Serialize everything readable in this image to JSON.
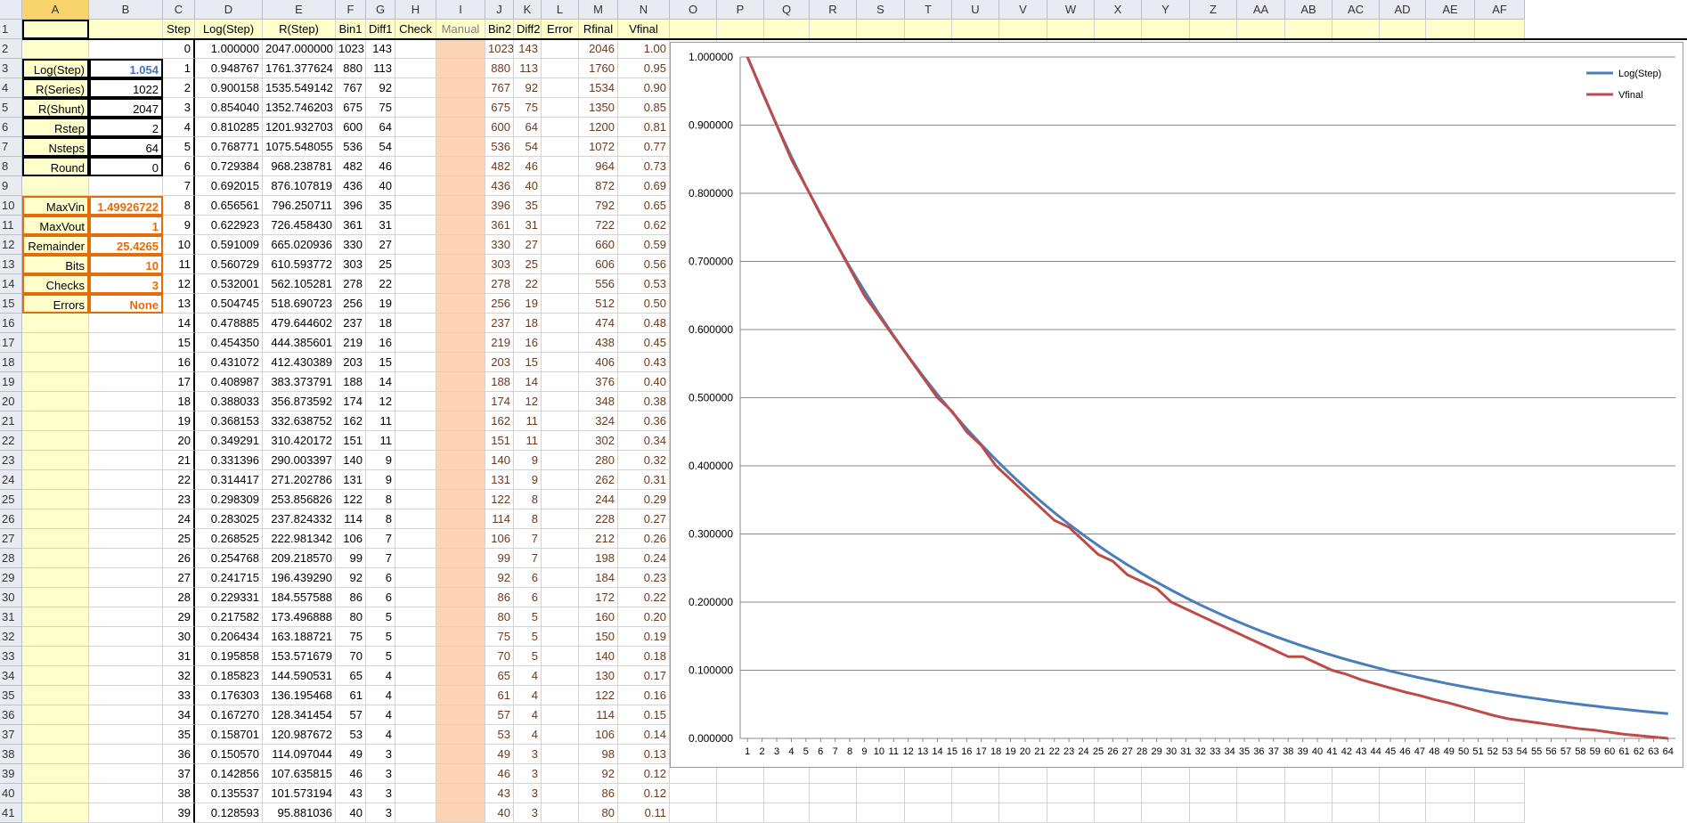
{
  "col_headers": [
    "A",
    "B",
    "C",
    "D",
    "E",
    "F",
    "G",
    "H",
    "I",
    "J",
    "K",
    "L",
    "M",
    "N",
    "O",
    "P",
    "Q",
    "R",
    "S",
    "T",
    "U",
    "V",
    "W",
    "X",
    "Y",
    "Z",
    "AA",
    "AB",
    "AC",
    "AD",
    "AE",
    "AF"
  ],
  "row1_headers": [
    "",
    "",
    "Step",
    "Log(Step)",
    "R(Step)",
    "Bin1",
    "Diff1",
    "Check",
    "Manual",
    "Bin2",
    "Diff2",
    "Error",
    "Rfinal",
    "Vfinal"
  ],
  "params_blue": [
    {
      "label": "Log(Step)",
      "value": "1.054"
    },
    {
      "label": "R(Series)",
      "value": "1022"
    },
    {
      "label": "R(Shunt)",
      "value": "2047"
    },
    {
      "label": "Rstep",
      "value": "2"
    },
    {
      "label": "Nsteps",
      "value": "64"
    },
    {
      "label": "Round",
      "value": "0"
    }
  ],
  "params_orange": [
    {
      "label": "MaxVin",
      "value": "1.49926722"
    },
    {
      "label": "MaxVout",
      "value": "1"
    },
    {
      "label": "Remainder",
      "value": "25.4265"
    },
    {
      "label": "Bits",
      "value": "10"
    },
    {
      "label": "Checks",
      "value": "3"
    },
    {
      "label": "Errors",
      "value": "None"
    }
  ],
  "rows": [
    [
      "0",
      "1.000000",
      "2047.000000",
      "1023",
      "143",
      "1023",
      "143",
      "2046",
      "1.00"
    ],
    [
      "1",
      "0.948767",
      "1761.377624",
      "880",
      "113",
      "880",
      "113",
      "1760",
      "0.95"
    ],
    [
      "2",
      "0.900158",
      "1535.549142",
      "767",
      "92",
      "767",
      "92",
      "1534",
      "0.90"
    ],
    [
      "3",
      "0.854040",
      "1352.746203",
      "675",
      "75",
      "675",
      "75",
      "1350",
      "0.85"
    ],
    [
      "4",
      "0.810285",
      "1201.932703",
      "600",
      "64",
      "600",
      "64",
      "1200",
      "0.81"
    ],
    [
      "5",
      "0.768771",
      "1075.548055",
      "536",
      "54",
      "536",
      "54",
      "1072",
      "0.77"
    ],
    [
      "6",
      "0.729384",
      "968.238781",
      "482",
      "46",
      "482",
      "46",
      "964",
      "0.73"
    ],
    [
      "7",
      "0.692015",
      "876.107819",
      "436",
      "40",
      "436",
      "40",
      "872",
      "0.69"
    ],
    [
      "8",
      "0.656561",
      "796.250711",
      "396",
      "35",
      "396",
      "35",
      "792",
      "0.65"
    ],
    [
      "9",
      "0.622923",
      "726.458430",
      "361",
      "31",
      "361",
      "31",
      "722",
      "0.62"
    ],
    [
      "10",
      "0.591009",
      "665.020936",
      "330",
      "27",
      "330",
      "27",
      "660",
      "0.59"
    ],
    [
      "11",
      "0.560729",
      "610.593772",
      "303",
      "25",
      "303",
      "25",
      "606",
      "0.56"
    ],
    [
      "12",
      "0.532001",
      "562.105281",
      "278",
      "22",
      "278",
      "22",
      "556",
      "0.53"
    ],
    [
      "13",
      "0.504745",
      "518.690723",
      "256",
      "19",
      "256",
      "19",
      "512",
      "0.50"
    ],
    [
      "14",
      "0.478885",
      "479.644602",
      "237",
      "18",
      "237",
      "18",
      "474",
      "0.48"
    ],
    [
      "15",
      "0.454350",
      "444.385601",
      "219",
      "16",
      "219",
      "16",
      "438",
      "0.45"
    ],
    [
      "16",
      "0.431072",
      "412.430389",
      "203",
      "15",
      "203",
      "15",
      "406",
      "0.43"
    ],
    [
      "17",
      "0.408987",
      "383.373791",
      "188",
      "14",
      "188",
      "14",
      "376",
      "0.40"
    ],
    [
      "18",
      "0.388033",
      "356.873592",
      "174",
      "12",
      "174",
      "12",
      "348",
      "0.38"
    ],
    [
      "19",
      "0.368153",
      "332.638752",
      "162",
      "11",
      "162",
      "11",
      "324",
      "0.36"
    ],
    [
      "20",
      "0.349291",
      "310.420172",
      "151",
      "11",
      "151",
      "11",
      "302",
      "0.34"
    ],
    [
      "21",
      "0.331396",
      "290.003397",
      "140",
      "9",
      "140",
      "9",
      "280",
      "0.32"
    ],
    [
      "22",
      "0.314417",
      "271.202786",
      "131",
      "9",
      "131",
      "9",
      "262",
      "0.31"
    ],
    [
      "23",
      "0.298309",
      "253.856826",
      "122",
      "8",
      "122",
      "8",
      "244",
      "0.29"
    ],
    [
      "24",
      "0.283025",
      "237.824332",
      "114",
      "8",
      "114",
      "8",
      "228",
      "0.27"
    ],
    [
      "25",
      "0.268525",
      "222.981342",
      "106",
      "7",
      "106",
      "7",
      "212",
      "0.26"
    ],
    [
      "26",
      "0.254768",
      "209.218570",
      "99",
      "7",
      "99",
      "7",
      "198",
      "0.24"
    ],
    [
      "27",
      "0.241715",
      "196.439290",
      "92",
      "6",
      "92",
      "6",
      "184",
      "0.23"
    ],
    [
      "28",
      "0.229331",
      "184.557588",
      "86",
      "6",
      "86",
      "6",
      "172",
      "0.22"
    ],
    [
      "29",
      "0.217582",
      "173.496888",
      "80",
      "5",
      "80",
      "5",
      "160",
      "0.20"
    ],
    [
      "30",
      "0.206434",
      "163.188721",
      "75",
      "5",
      "75",
      "5",
      "150",
      "0.19"
    ],
    [
      "31",
      "0.195858",
      "153.571679",
      "70",
      "5",
      "70",
      "5",
      "140",
      "0.18"
    ],
    [
      "32",
      "0.185823",
      "144.590531",
      "65",
      "4",
      "65",
      "4",
      "130",
      "0.17"
    ],
    [
      "33",
      "0.176303",
      "136.195468",
      "61",
      "4",
      "61",
      "4",
      "122",
      "0.16"
    ],
    [
      "34",
      "0.167270",
      "128.341454",
      "57",
      "4",
      "57",
      "4",
      "114",
      "0.15"
    ],
    [
      "35",
      "0.158701",
      "120.987672",
      "53",
      "4",
      "53",
      "4",
      "106",
      "0.14"
    ],
    [
      "36",
      "0.150570",
      "114.097044",
      "49",
      "3",
      "49",
      "3",
      "98",
      "0.13"
    ],
    [
      "37",
      "0.142856",
      "107.635815",
      "46",
      "3",
      "46",
      "3",
      "92",
      "0.12"
    ],
    [
      "38",
      "0.135537",
      "101.573194",
      "43",
      "3",
      "43",
      "3",
      "86",
      "0.12"
    ],
    [
      "39",
      "0.128593",
      "95.881036",
      "40",
      "3",
      "40",
      "3",
      "80",
      "0.11"
    ]
  ],
  "chart_data": {
    "type": "line",
    "title": "",
    "xlabel": "",
    "ylabel": "",
    "legend_position": "top-right",
    "grid": true,
    "x": [
      1,
      2,
      3,
      4,
      5,
      6,
      7,
      8,
      9,
      10,
      11,
      12,
      13,
      14,
      15,
      16,
      17,
      18,
      19,
      20,
      21,
      22,
      23,
      24,
      25,
      26,
      27,
      28,
      29,
      30,
      31,
      32,
      33,
      34,
      35,
      36,
      37,
      38,
      39,
      40,
      41,
      42,
      43,
      44,
      45,
      46,
      47,
      48,
      49,
      50,
      51,
      52,
      53,
      54,
      55,
      56,
      57,
      58,
      59,
      60,
      61,
      62,
      63,
      64
    ],
    "ylim": [
      0,
      1
    ],
    "yticks": [
      "0.000000",
      "0.100000",
      "0.200000",
      "0.300000",
      "0.400000",
      "0.500000",
      "0.600000",
      "0.700000",
      "0.800000",
      "0.900000",
      "1.000000"
    ],
    "series": [
      {
        "name": "Log(Step)",
        "color": "#4a7ebb",
        "values": [
          1.0,
          0.948767,
          0.900158,
          0.85404,
          0.810285,
          0.768771,
          0.729384,
          0.692015,
          0.656561,
          0.622923,
          0.591009,
          0.560729,
          0.532001,
          0.504745,
          0.478885,
          0.45435,
          0.431072,
          0.408987,
          0.388033,
          0.368153,
          0.349291,
          0.331396,
          0.314417,
          0.298309,
          0.283025,
          0.268525,
          0.254768,
          0.241715,
          0.229331,
          0.217582,
          0.206434,
          0.195858,
          0.185823,
          0.176303,
          0.16727,
          0.158701,
          0.15057,
          0.142856,
          0.135537,
          0.128593,
          0.122,
          0.1157,
          0.1098,
          0.1042,
          0.0988,
          0.0937,
          0.0889,
          0.0844,
          0.08,
          0.0759,
          0.072,
          0.0683,
          0.0648,
          0.0615,
          0.0584,
          0.0554,
          0.0525,
          0.0498,
          0.0473,
          0.0449,
          0.0426,
          0.0404,
          0.0383,
          0.0363
        ]
      },
      {
        "name": "Vfinal",
        "color": "#be4b48",
        "values": [
          1.0,
          0.95,
          0.9,
          0.85,
          0.81,
          0.77,
          0.73,
          0.69,
          0.65,
          0.62,
          0.59,
          0.56,
          0.53,
          0.5,
          0.48,
          0.45,
          0.43,
          0.4,
          0.38,
          0.36,
          0.34,
          0.32,
          0.31,
          0.29,
          0.27,
          0.26,
          0.24,
          0.23,
          0.22,
          0.2,
          0.19,
          0.18,
          0.17,
          0.16,
          0.15,
          0.14,
          0.13,
          0.12,
          0.12,
          0.11,
          0.1,
          0.094,
          0.086,
          0.08,
          0.074,
          0.068,
          0.063,
          0.057,
          0.052,
          0.046,
          0.04,
          0.034,
          0.029,
          0.026,
          0.023,
          0.02,
          0.017,
          0.014,
          0.012,
          0.009,
          0.006,
          0.004,
          0.002,
          0.0
        ]
      }
    ]
  }
}
